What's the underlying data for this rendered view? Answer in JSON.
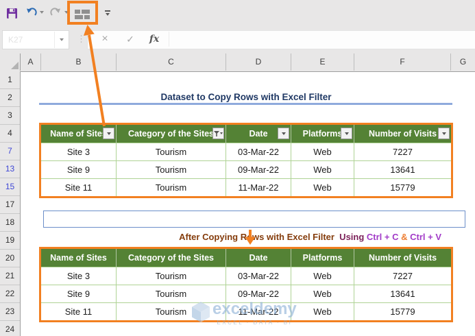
{
  "toolbar": {
    "icons": {
      "save": "save-icon",
      "undo": "undo-icon",
      "redo": "redo-icon",
      "highlighted": "grid-squares-icon",
      "customize": "customize-quick-access-toolbar-icon"
    },
    "highlight_color": "#F28021"
  },
  "formula_bar": {
    "name_box_value": "K27",
    "cancel_label": "×",
    "enter_label": "✓",
    "fx_label": "fx"
  },
  "grid": {
    "column_headers": [
      "A",
      "B",
      "C",
      "D",
      "E",
      "F",
      "G"
    ],
    "row_headers": [
      "1",
      "2",
      "3",
      "4",
      "7",
      "13",
      "15",
      "17",
      "18",
      "19",
      "20",
      "21",
      "22",
      "23",
      "24"
    ],
    "filtered_rows": [
      "7",
      "13",
      "15"
    ],
    "filtered_row_color": "#3F47D6"
  },
  "sheet": {
    "title": "Dataset to Copy Rows with Excel Filter",
    "subtitle": {
      "main": "After Copying Rows with Excel Filter ",
      "using": " Using ",
      "ctrl_c": "Ctrl + C",
      "amp": " & ",
      "ctrl_v": "Ctrl + V"
    }
  },
  "table": {
    "columns": [
      "Name of Sites",
      "Category of the Sites",
      "Date",
      "Platforms",
      "Number of Visits"
    ],
    "filtered_column": "Category of the Sites",
    "rows": [
      [
        "Site 3",
        "Tourism",
        "03-Mar-22",
        "Web",
        "7227"
      ],
      [
        "Site 9",
        "Tourism",
        "09-Mar-22",
        "Web",
        "13641"
      ],
      [
        "Site 11",
        "Tourism",
        "11-Mar-22",
        "Web",
        "15779"
      ]
    ]
  },
  "watermark": {
    "brand": "exceldemy",
    "tagline": "EXCEL · DATA · BI"
  },
  "colors": {
    "header_green": "#548235",
    "accent_orange": "#F28021",
    "title_navy": "#1F3864",
    "subtitle_brown": "#843C0C",
    "using_maroon": "#7B2159",
    "ctrl_purple": "#A23BC8",
    "underline_blue": "#8FAADC",
    "cell_border_green": "#AFD395"
  }
}
